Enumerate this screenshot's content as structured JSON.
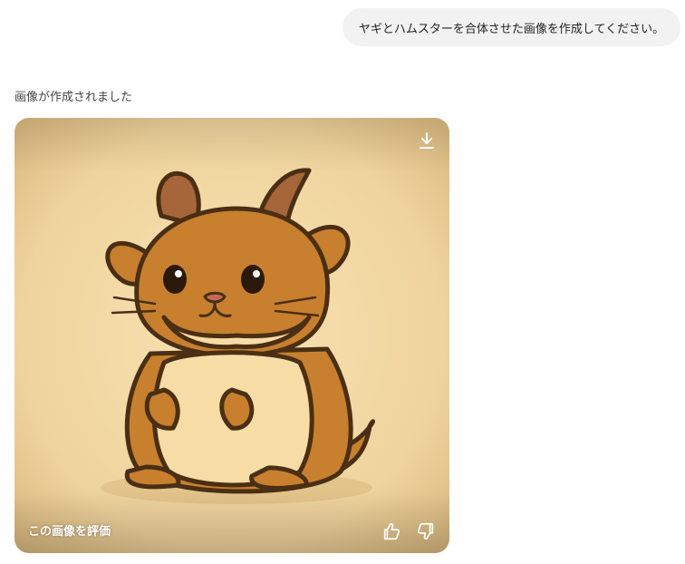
{
  "conversation": {
    "user_message": "ヤギとハムスターを合体させた画像を作成してください。",
    "assistant_status": "画像が作成されました"
  },
  "generated_image": {
    "subject": "goat-hamster",
    "rate_label": "この画像を評価",
    "icons": {
      "download": "download-icon",
      "like": "thumbs-up-icon",
      "dislike": "thumbs-down-icon"
    },
    "colors": {
      "background": "#f1d9a6",
      "fur": "#c8802e",
      "belly": "#f8dca6",
      "outline": "#4a2f14",
      "horn": "#a7663a"
    }
  }
}
